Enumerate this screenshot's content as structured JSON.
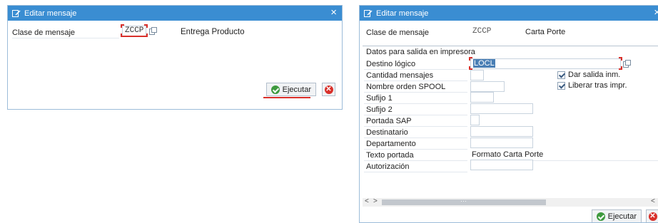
{
  "left_dialog": {
    "title": "Editar mensaje",
    "close_glyph": "×",
    "clase_label": "Clase de mensaje",
    "clase_value": "ZCCP",
    "clase_desc": "Entrega Producto",
    "execute_label": "Ejecutar"
  },
  "right_dialog": {
    "title": "Editar mensaje",
    "close_glyph": "×",
    "clase_label": "Clase de mensaje",
    "clase_value": "ZCCP",
    "clase_desc": "Carta Porte",
    "section_title": "Datos para salida en impresora",
    "fields": [
      {
        "label": "Destino lógico",
        "value": "LOCL"
      },
      {
        "label": "Cantidad mensajes",
        "value": ""
      },
      {
        "label": "Nombre orden SPOOL",
        "value": ""
      },
      {
        "label": "Sufijo 1",
        "value": ""
      },
      {
        "label": "Sufijo 2",
        "value": ""
      },
      {
        "label": "Portada SAP",
        "value": ""
      },
      {
        "label": "Destinatario",
        "value": ""
      },
      {
        "label": "Departamento",
        "value": ""
      },
      {
        "label": "Texto portada",
        "value": "Formato Carta Porte"
      },
      {
        "label": "Autorización",
        "value": ""
      }
    ],
    "checkboxes": [
      {
        "label": "Dar salida inm.",
        "checked": true
      },
      {
        "label": "Liberar tras impr.",
        "checked": true
      }
    ],
    "scroll_left": "<",
    "scroll_right": ">",
    "scroll_far": "<",
    "scroll_dots": "···",
    "execute_label": "Ejecutar"
  },
  "icons": {
    "title": "edit-message-icon",
    "ok": "green-check-icon",
    "cancel": "red-cancel-icon",
    "f4": "value-help-icon"
  },
  "colors": {
    "titlebar": "#3a8dd2",
    "focus_marker": "#d9302a",
    "ok_green": "#3e9a3e",
    "cancel_red": "#d9302a"
  }
}
